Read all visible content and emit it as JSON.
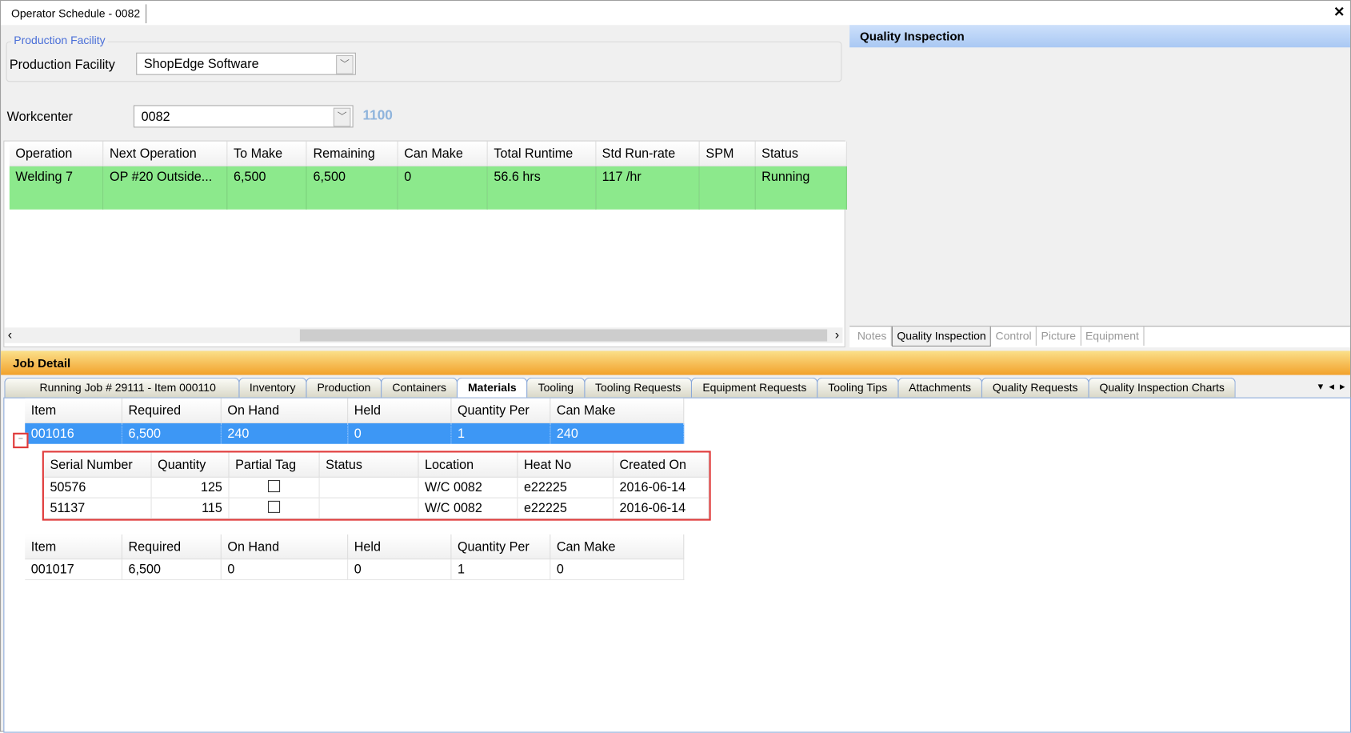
{
  "window": {
    "tab_title": "Operator Schedule - 0082",
    "close": "✕"
  },
  "facility": {
    "group_label": "Production Facility",
    "label": "Production Facility",
    "value": "ShopEdge Software"
  },
  "workcenter": {
    "label": "Workcenter",
    "value": "0082",
    "code": "1100"
  },
  "operations": {
    "columns": [
      "Operation",
      "Next Operation",
      "To Make",
      "Remaining",
      "Can Make",
      "Total Runtime",
      "Std Run-rate",
      "SPM",
      "Status"
    ],
    "rows": [
      [
        "Welding 7",
        "OP  #20  Outside...",
        "6,500",
        "6,500",
        "0",
        "56.6 hrs",
        "117 /hr",
        "",
        "Running"
      ]
    ],
    "row_color": "#8ce98c"
  },
  "quality_panel": {
    "title": "Quality Inspection",
    "tabs": [
      "Notes",
      "Quality Inspection",
      "Control",
      "Picture",
      "Equipment"
    ],
    "active_tab": "Quality Inspection"
  },
  "job_detail": {
    "title": "Job Detail",
    "tabs": [
      "Running Job # 29111 - Item 000110",
      "Inventory",
      "Production",
      "Containers",
      "Materials",
      "Tooling",
      "Tooling Requests",
      "Equipment Requests",
      "Tooling Tips",
      "Attachments",
      "Quality Requests",
      "Quality Inspection Charts"
    ],
    "active_tab": "Materials",
    "materials": {
      "columns": [
        "Item",
        "Required",
        "On Hand",
        "Held",
        "Quantity Per",
        "Can Make"
      ],
      "items": [
        {
          "cells": [
            "001016",
            "6,500",
            "240",
            "0",
            "1",
            "240"
          ],
          "selected": true,
          "expanded": true,
          "tags": {
            "columns": [
              "Serial Number",
              "Quantity",
              "Partial Tag",
              "Status",
              "Location",
              "Heat No",
              "Created On"
            ],
            "rows": [
              [
                "50576",
                "125",
                "",
                "",
                "W/C 0082",
                "e22225",
                "2016-06-14"
              ],
              [
                "51137",
                "115",
                "",
                "",
                "W/C 0082",
                "e22225",
                "2016-06-14"
              ]
            ]
          }
        },
        {
          "cells": [
            "001017",
            "6,500",
            "0",
            "0",
            "1",
            "0"
          ],
          "selected": false,
          "expanded": false
        }
      ]
    }
  },
  "colors": {
    "selection": "#3d97f5",
    "highlight_box": "#e03a3a",
    "job_header": "#f2a12b",
    "quality_header": "#a9c8f3"
  }
}
